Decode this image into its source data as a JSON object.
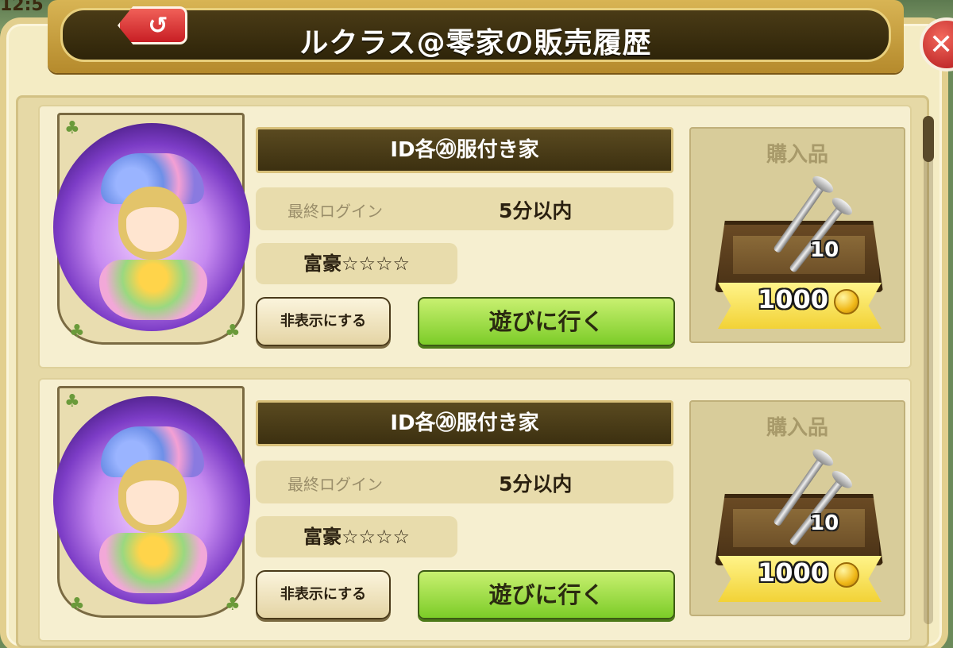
{
  "status_bar": {
    "clock_fragment": "12:5"
  },
  "header": {
    "title": "ルクラス@零家の販売履歴",
    "back_icon": "↺",
    "close_icon": "✕"
  },
  "listings": [
    {
      "house_name": "ID各⑳服付き家",
      "last_login_label": "最終ログイン",
      "last_login_value": "5分以内",
      "rank": "富豪☆☆☆☆",
      "hide_label": "非表示にする",
      "visit_label": "遊びに行く",
      "purchase_title": "購入品",
      "item_icon": "nails-in-crate-icon",
      "item_count": "10",
      "price": "1000",
      "currency_icon": "coin-icon"
    },
    {
      "house_name": "ID各⑳服付き家",
      "last_login_label": "最終ログイン",
      "last_login_value": "5分以内",
      "rank": "富豪☆☆☆☆",
      "hide_label": "非表示にする",
      "visit_label": "遊びに行く",
      "purchase_title": "購入品",
      "item_icon": "nails-in-crate-icon",
      "item_count": "10",
      "price": "1000",
      "currency_icon": "coin-icon"
    }
  ],
  "colors": {
    "panel_bg": "#f4ecc4",
    "header_dark": "#3c3010",
    "visit_button": "#7ccc28",
    "back_close_red": "#c81e24"
  }
}
